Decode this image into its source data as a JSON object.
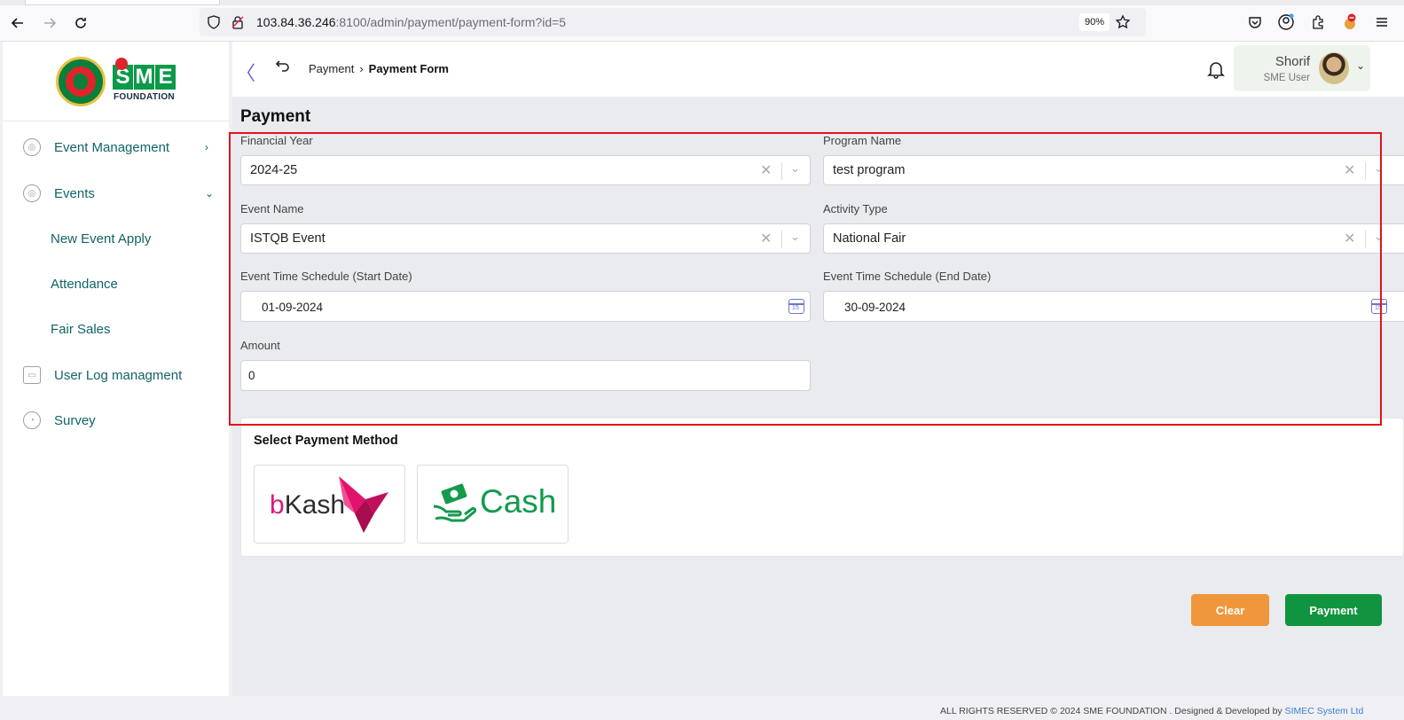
{
  "browser": {
    "url_host": "103.84.36.246",
    "url_rest": ":8100/admin/payment/payment-form?id=5",
    "zoom": "90%"
  },
  "sidebar": {
    "logo_text": "SME",
    "logo_sub": "FOUNDATION",
    "items": [
      {
        "label": "Event Management",
        "chevron": "›"
      },
      {
        "label": "Events",
        "chevron": "⌄"
      },
      {
        "label": "New Event Apply"
      },
      {
        "label": "Attendance"
      },
      {
        "label": "Fair Sales"
      },
      {
        "label": "User Log managment"
      },
      {
        "label": "Survey"
      }
    ]
  },
  "topbar": {
    "breadcrumb_parent": "Payment",
    "breadcrumb_separator": "›",
    "breadcrumb_current": "Payment Form",
    "user_name": "Shorif",
    "user_role": "SME User"
  },
  "form": {
    "title": "Payment",
    "financial_year_label": "Financial Year",
    "financial_year_value": "2024-25",
    "program_name_label": "Program Name",
    "program_name_value": "test program",
    "event_name_label": "Event Name",
    "event_name_value": "ISTQB Event",
    "activity_type_label": "Activity Type",
    "activity_type_value": "National Fair",
    "start_date_label": "Event Time Schedule (Start Date)",
    "start_date_value": "01-09-2024",
    "end_date_label": "Event Time Schedule (End Date)",
    "end_date_value": "30-09-2024",
    "amount_label": "Amount",
    "amount_value": "0"
  },
  "payment": {
    "title": "Select Payment Method",
    "bkash_b": "b",
    "bkash_rest": "Kash",
    "cash_label": "Cash"
  },
  "actions": {
    "clear_label": "Clear",
    "payment_label": "Payment"
  },
  "footer": {
    "text": "ALL RIGHTS RESERVED © 2024 SME FOUNDATION . Designed & Developed by",
    "link": "SIMEC System Ltd"
  },
  "colors": {
    "accent_teal": "#116466",
    "clear_orange": "#f0973d",
    "payment_green": "#11943f",
    "highlight_red": "#e3131b"
  }
}
